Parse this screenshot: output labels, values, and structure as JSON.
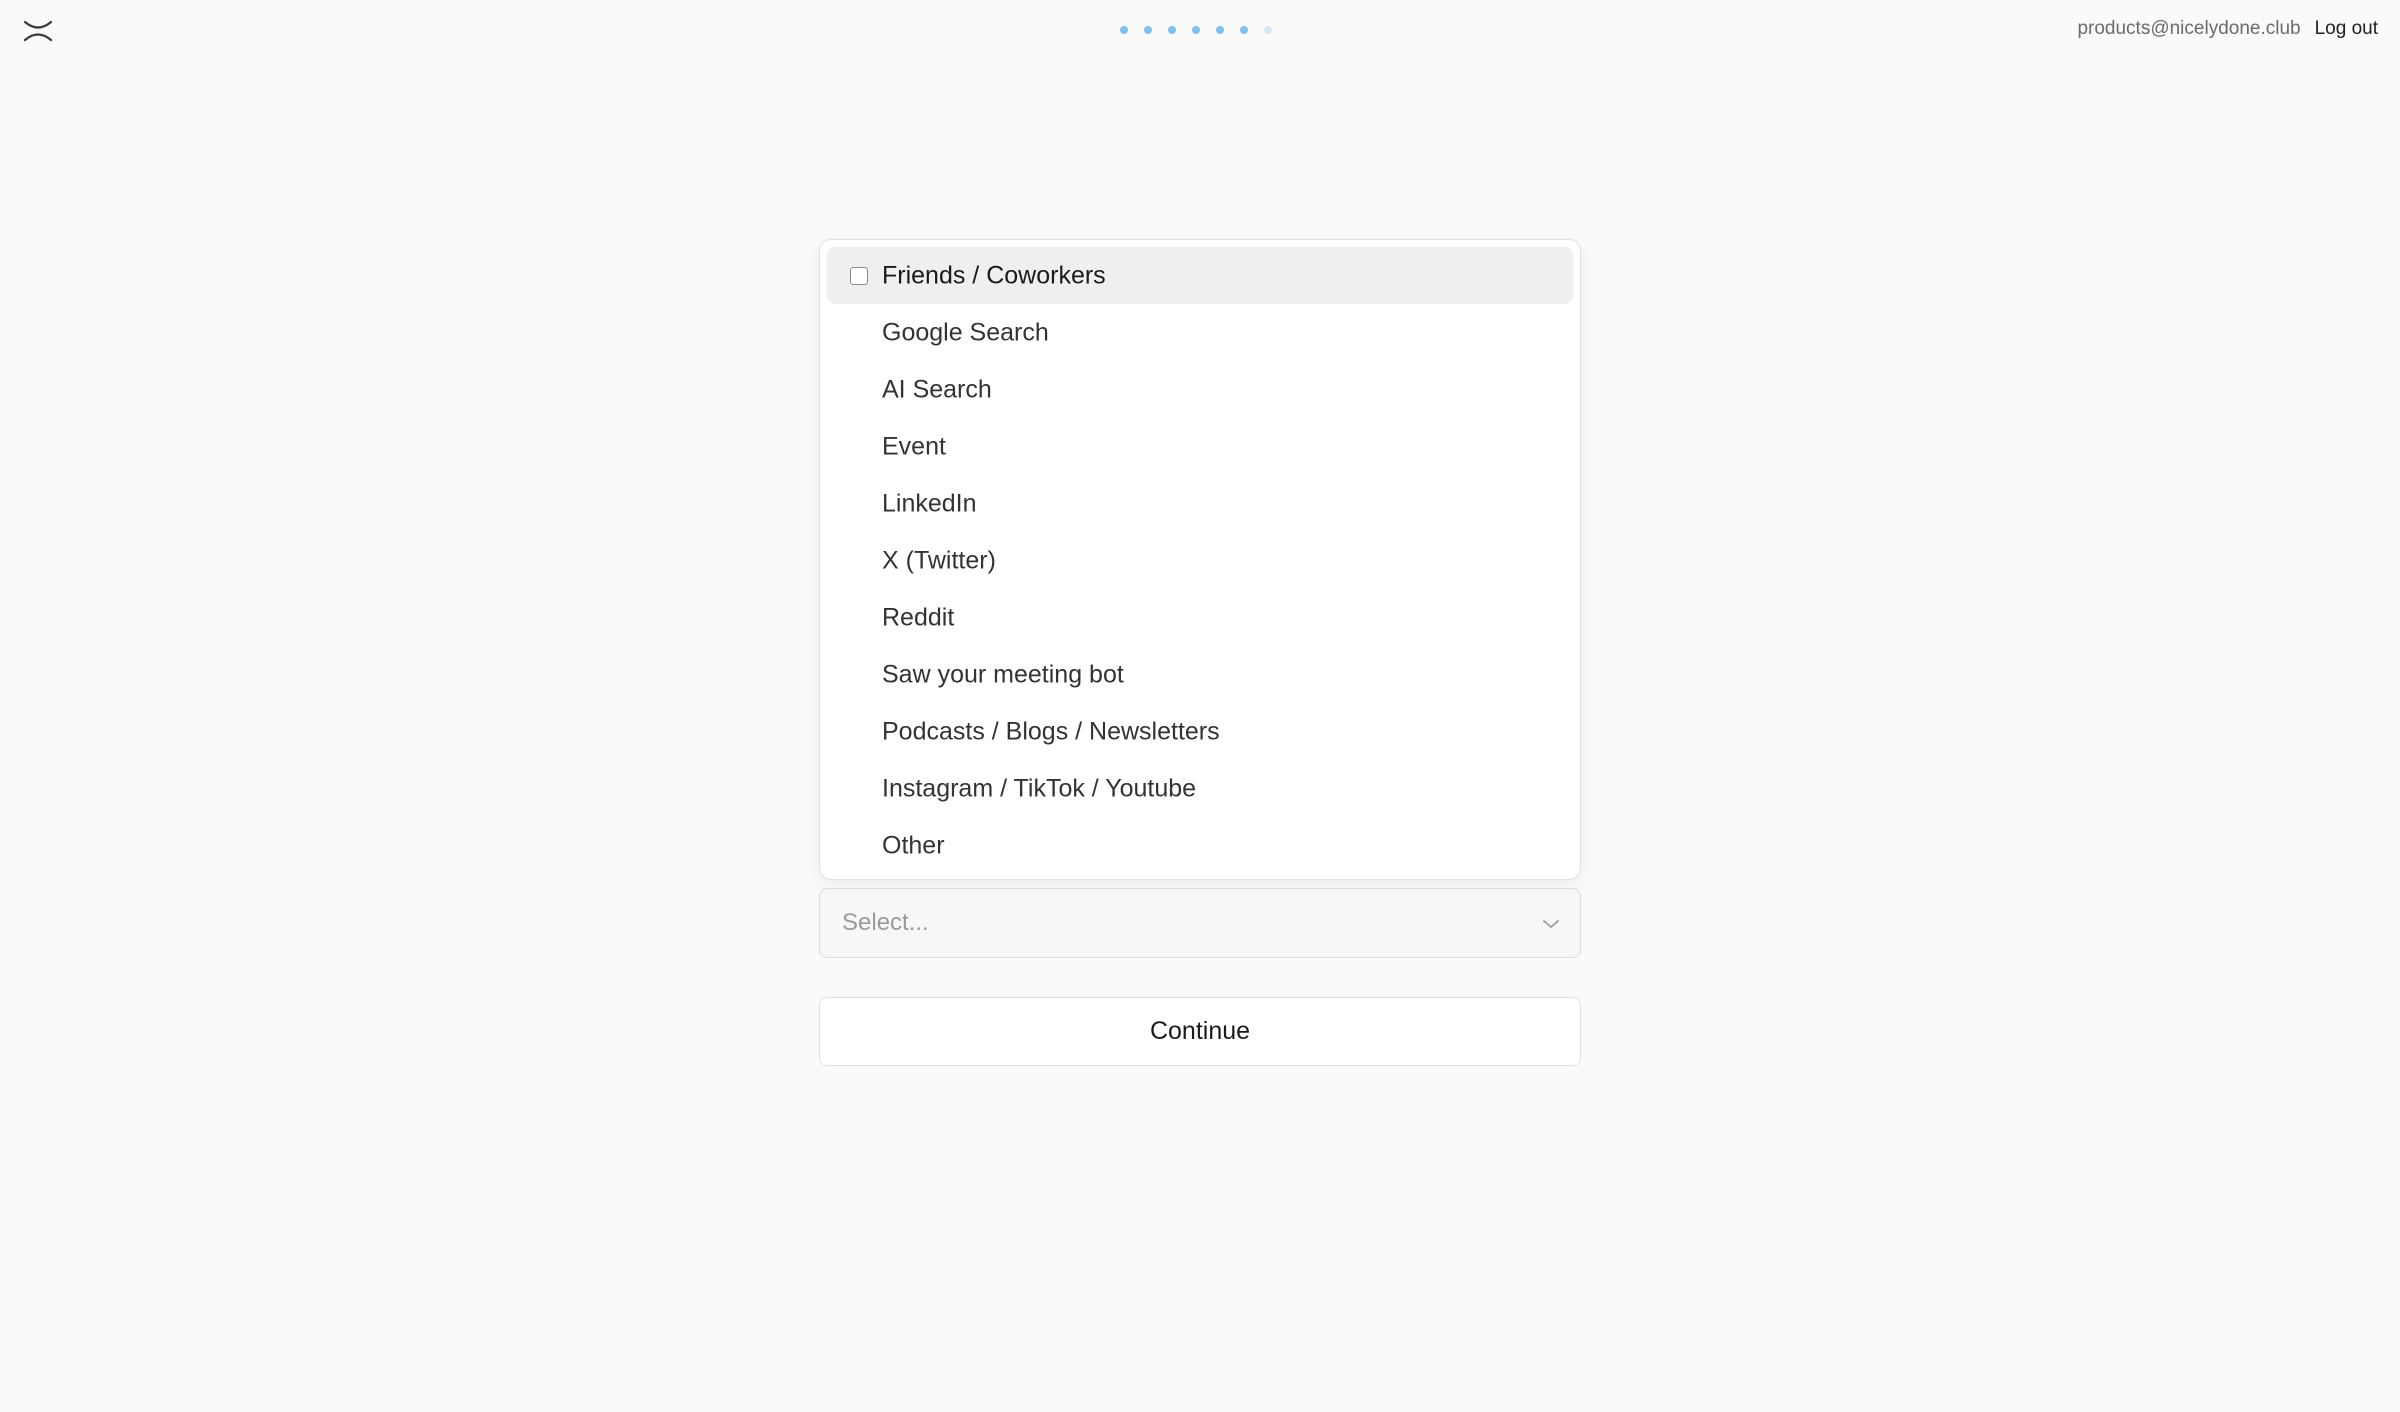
{
  "header": {
    "logo_icon": "close-x-logo-icon",
    "user_email": "products@nicelydone.club",
    "logout_label": "Log out"
  },
  "progress": {
    "total_steps": 7,
    "completed_steps": 6,
    "active_color": "#7cc0ee",
    "inactive_color": "#d8e8f3"
  },
  "dropdown": {
    "options": [
      {
        "label": "Friends / Coworkers",
        "highlighted": true
      },
      {
        "label": "Google Search",
        "highlighted": false
      },
      {
        "label": "AI Search",
        "highlighted": false
      },
      {
        "label": "Event",
        "highlighted": false
      },
      {
        "label": "LinkedIn",
        "highlighted": false
      },
      {
        "label": "X (Twitter)",
        "highlighted": false
      },
      {
        "label": "Reddit",
        "highlighted": false
      },
      {
        "label": "Saw your meeting bot",
        "highlighted": false
      },
      {
        "label": "Podcasts / Blogs / Newsletters",
        "highlighted": false
      },
      {
        "label": "Instagram / TikTok / Youtube",
        "highlighted": false
      },
      {
        "label": "Other",
        "highlighted": false
      }
    ]
  },
  "select": {
    "placeholder": "Select...",
    "chevron_icon": "chevron-down-icon"
  },
  "continue_label": "Continue"
}
